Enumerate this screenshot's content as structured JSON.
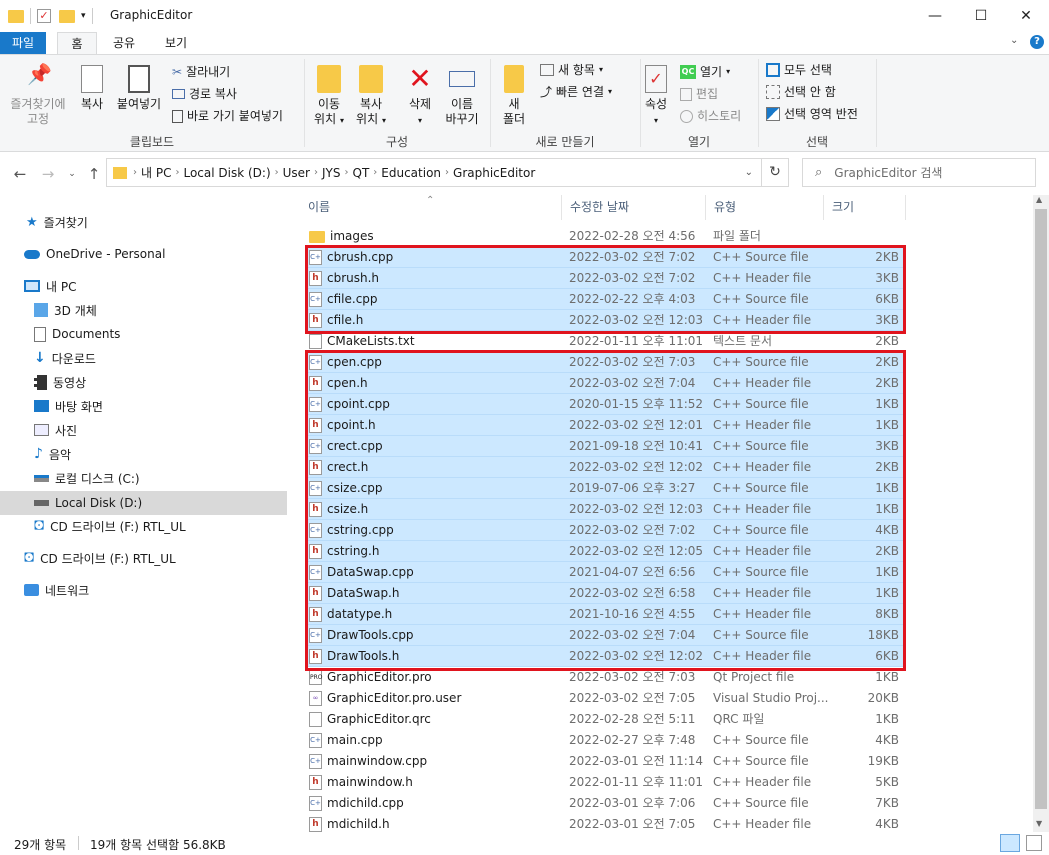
{
  "window": {
    "title": "GraphicEditor"
  },
  "window_buttons": {
    "minimize": "—",
    "maximize": "☐",
    "close": "✕"
  },
  "tabs": {
    "file": "파일",
    "home": "홈",
    "share": "공유",
    "view": "보기"
  },
  "ribbon": {
    "pin": [
      "즐겨찾기에",
      "고정"
    ],
    "copy": "복사",
    "paste": "붙여넣기",
    "cut": "잘라내기",
    "copy_path": "경로 복사",
    "paste_shortcut": "바로 가기 붙여넣기",
    "clipboard_label": "클립보드",
    "move_to": [
      "이동",
      "위치"
    ],
    "copy_to": [
      "복사",
      "위치"
    ],
    "delete": "삭제",
    "rename": [
      "이름",
      "바꾸기"
    ],
    "organize_label": "구성",
    "new_folder": [
      "새",
      "폴더"
    ],
    "new_item": "새 항목",
    "easy_access": "빠른 연결",
    "new_label": "새로 만들기",
    "properties": "속성",
    "open": "열기",
    "edit": "편집",
    "history": "히스토리",
    "open_label": "열기",
    "select_all": "모두 선택",
    "select_none": "선택 안 함",
    "invert_selection": "선택 영역 반전",
    "select_label": "선택"
  },
  "address": {
    "segments": [
      "내 PC",
      "Local Disk (D:)",
      "User",
      "JYS",
      "QT",
      "Education",
      "GraphicEditor"
    ],
    "search_placeholder": "GraphicEditor 검색"
  },
  "nav": {
    "quick_access": "즐겨찾기",
    "onedrive": "OneDrive - Personal",
    "this_pc": "내 PC",
    "objects3d": "3D 개체",
    "documents": "Documents",
    "downloads": "다운로드",
    "videos": "동영상",
    "desktop": "바탕 화면",
    "pictures": "사진",
    "music": "음악",
    "local_c": "로컬 디스크 (C:)",
    "local_d": "Local Disk (D:)",
    "cd_f_sub": "CD 드라이브 (F:) RTL_UL",
    "cd_f": "CD 드라이브 (F:) RTL_UL",
    "network": "네트워크"
  },
  "columns": {
    "name": "이름",
    "date": "수정한 날짜",
    "type": "유형",
    "size": "크기"
  },
  "files": [
    {
      "name": "images",
      "date": "2022-02-28 오전 4:56",
      "type": "파일 폴더",
      "size": "",
      "icon": "folder",
      "sel": false
    },
    {
      "name": "cbrush.cpp",
      "date": "2022-03-02 오전 7:02",
      "type": "C++ Source file",
      "size": "2KB",
      "icon": "cpp",
      "sel": true
    },
    {
      "name": "cbrush.h",
      "date": "2022-03-02 오전 7:02",
      "type": "C++ Header file",
      "size": "3KB",
      "icon": "h",
      "sel": true
    },
    {
      "name": "cfile.cpp",
      "date": "2022-02-22 오후 4:03",
      "type": "C++ Source file",
      "size": "6KB",
      "icon": "cpp",
      "sel": true
    },
    {
      "name": "cfile.h",
      "date": "2022-03-02 오전 12:03",
      "type": "C++ Header file",
      "size": "3KB",
      "icon": "h",
      "sel": true
    },
    {
      "name": "CMakeLists.txt",
      "date": "2022-01-11 오후 11:01",
      "type": "텍스트 문서",
      "size": "2KB",
      "icon": "txt",
      "sel": false
    },
    {
      "name": "cpen.cpp",
      "date": "2022-03-02 오전 7:03",
      "type": "C++ Source file",
      "size": "2KB",
      "icon": "cpp",
      "sel": true
    },
    {
      "name": "cpen.h",
      "date": "2022-03-02 오전 7:04",
      "type": "C++ Header file",
      "size": "2KB",
      "icon": "h",
      "sel": true
    },
    {
      "name": "cpoint.cpp",
      "date": "2020-01-15 오후 11:52",
      "type": "C++ Source file",
      "size": "1KB",
      "icon": "cpp",
      "sel": true
    },
    {
      "name": "cpoint.h",
      "date": "2022-03-02 오전 12:01",
      "type": "C++ Header file",
      "size": "1KB",
      "icon": "h",
      "sel": true
    },
    {
      "name": "crect.cpp",
      "date": "2021-09-18 오전 10:41",
      "type": "C++ Source file",
      "size": "3KB",
      "icon": "cpp",
      "sel": true
    },
    {
      "name": "crect.h",
      "date": "2022-03-02 오전 12:02",
      "type": "C++ Header file",
      "size": "2KB",
      "icon": "h",
      "sel": true
    },
    {
      "name": "csize.cpp",
      "date": "2019-07-06 오후 3:27",
      "type": "C++ Source file",
      "size": "1KB",
      "icon": "cpp",
      "sel": true
    },
    {
      "name": "csize.h",
      "date": "2022-03-02 오전 12:03",
      "type": "C++ Header file",
      "size": "1KB",
      "icon": "h",
      "sel": true
    },
    {
      "name": "cstring.cpp",
      "date": "2022-03-02 오전 7:02",
      "type": "C++ Source file",
      "size": "4KB",
      "icon": "cpp",
      "sel": true
    },
    {
      "name": "cstring.h",
      "date": "2022-03-02 오전 12:05",
      "type": "C++ Header file",
      "size": "2KB",
      "icon": "h",
      "sel": true
    },
    {
      "name": "DataSwap.cpp",
      "date": "2021-04-07 오전 6:56",
      "type": "C++ Source file",
      "size": "1KB",
      "icon": "cpp",
      "sel": true
    },
    {
      "name": "DataSwap.h",
      "date": "2022-03-02 오전 6:58",
      "type": "C++ Header file",
      "size": "1KB",
      "icon": "h",
      "sel": true
    },
    {
      "name": "datatype.h",
      "date": "2021-10-16 오전 4:55",
      "type": "C++ Header file",
      "size": "8KB",
      "icon": "h",
      "sel": true
    },
    {
      "name": "DrawTools.cpp",
      "date": "2022-03-02 오전 7:04",
      "type": "C++ Source file",
      "size": "18KB",
      "icon": "cpp",
      "sel": true
    },
    {
      "name": "DrawTools.h",
      "date": "2022-03-02 오전 12:02",
      "type": "C++ Header file",
      "size": "6KB",
      "icon": "h",
      "sel": true
    },
    {
      "name": "GraphicEditor.pro",
      "date": "2022-03-02 오전 7:03",
      "type": "Qt Project file",
      "size": "1KB",
      "icon": "pro",
      "sel": false
    },
    {
      "name": "GraphicEditor.pro.user",
      "date": "2022-03-02 오전 7:05",
      "type": "Visual Studio Proj...",
      "size": "20KB",
      "icon": "user",
      "sel": false
    },
    {
      "name": "GraphicEditor.qrc",
      "date": "2022-02-28 오전 5:11",
      "type": "QRC 파일",
      "size": "1KB",
      "icon": "blank",
      "sel": false
    },
    {
      "name": "main.cpp",
      "date": "2022-02-27 오후 7:48",
      "type": "C++ Source file",
      "size": "4KB",
      "icon": "cpp",
      "sel": false
    },
    {
      "name": "mainwindow.cpp",
      "date": "2022-03-01 오전 11:14",
      "type": "C++ Source file",
      "size": "19KB",
      "icon": "cpp",
      "sel": false
    },
    {
      "name": "mainwindow.h",
      "date": "2022-01-11 오후 11:01",
      "type": "C++ Header file",
      "size": "5KB",
      "icon": "h",
      "sel": false
    },
    {
      "name": "mdichild.cpp",
      "date": "2022-03-01 오후 7:06",
      "type": "C++ Source file",
      "size": "7KB",
      "icon": "cpp",
      "sel": false
    },
    {
      "name": "mdichild.h",
      "date": "2022-03-01 오전 7:05",
      "type": "C++ Header file",
      "size": "4KB",
      "icon": "h",
      "sel": false
    }
  ],
  "status": {
    "count": "29개 항목",
    "selected": "19개 항목 선택함 56.8KB"
  },
  "colors": {
    "accent": "#1979ca",
    "selection": "#cce8ff",
    "highlight_box": "#e0141e",
    "folder": "#f7c948"
  }
}
